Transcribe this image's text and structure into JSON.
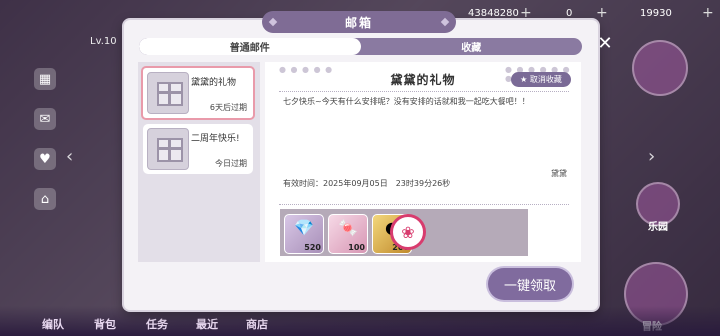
{
  "background": {
    "level": "Lv.10",
    "currencies": [
      {
        "value": "43848280"
      },
      {
        "value": "0"
      },
      {
        "value": "19930"
      }
    ],
    "bottom_nav": [
      "编队",
      "背包",
      "任务",
      "最近",
      "商店",
      "冒险"
    ],
    "right_labels": [
      "乐园",
      "冒险"
    ]
  },
  "dialog": {
    "title": "邮箱",
    "tabs": {
      "normal": "普通邮件",
      "favorites": "收藏"
    },
    "mails": [
      {
        "title": "黛黛的礼物",
        "expiry": "6天后过期"
      },
      {
        "title": "二周年快乐!",
        "expiry": "今日过期"
      }
    ],
    "content": {
      "title": "黛黛的礼物",
      "uncollect_label": "取消收藏",
      "body": "七夕快乐~今天有什么安排呢？没有安排的话就和我一起吃大餐吧！！",
      "sender": "黛黛",
      "valid_time": "有效时间：2025年09月05日　23时39分26秒"
    },
    "items": [
      {
        "icon": "diamond-icon",
        "count": "520"
      },
      {
        "icon": "candy-icon",
        "count": "100"
      },
      {
        "icon": "coin-icon",
        "count": "200"
      }
    ],
    "claim_all_label": "一键领取"
  }
}
